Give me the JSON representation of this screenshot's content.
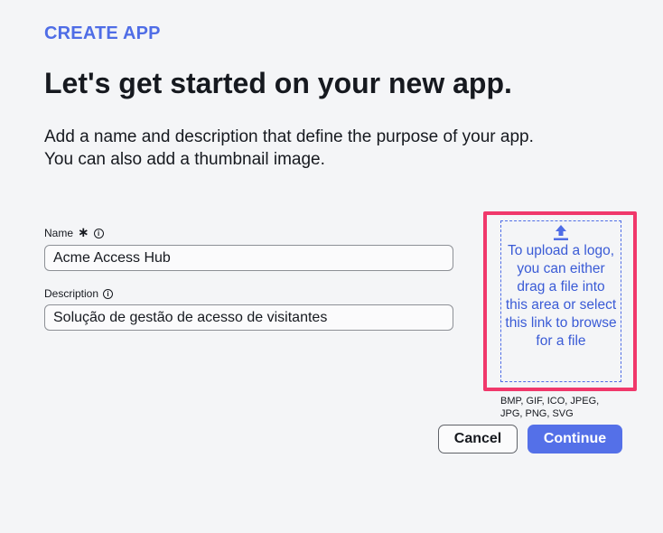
{
  "header": {
    "eyebrow": "CREATE APP",
    "title": "Let's get started on your new app.",
    "description_lines": [
      "Add a name and description that define the purpose of your app.",
      "You can also add a thumbnail image."
    ]
  },
  "form": {
    "name": {
      "label": "Name",
      "required_mark": "∗",
      "info_icon": "info-icon",
      "value": "Acme Access Hub"
    },
    "description": {
      "label": "Description",
      "info_icon": "info-icon",
      "value": "Solução de gestão de acesso de visitantes"
    }
  },
  "upload": {
    "icon": "upload-icon",
    "text": "To upload a logo, you can either drag a file into this area or select this link to browse for a file",
    "formats": "BMP, GIF, ICO, JPEG, JPG, PNG, SVG",
    "highlight_color": "#f0386b"
  },
  "actions": {
    "cancel_label": "Cancel",
    "continue_label": "Continue"
  },
  "colors": {
    "accent": "#4f6de6",
    "primary_button": "#5470e8",
    "background": "#f4f5f7"
  }
}
